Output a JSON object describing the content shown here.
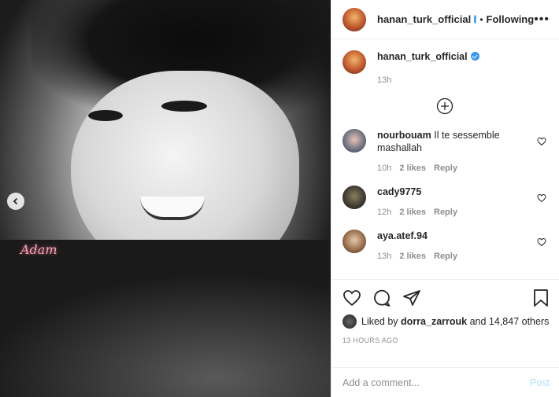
{
  "header": {
    "username": "hanan_turk_official",
    "separator": "•",
    "follow_label": "Following",
    "more_label": "•••"
  },
  "caption": {
    "username": "hanan_turk_official",
    "text": "",
    "time": "13h"
  },
  "image": {
    "overlay_text": "Adam"
  },
  "comments": [
    {
      "username": "nourbouam",
      "text": "Il te sessemble mashallah ",
      "time": "10h",
      "likes": "2 likes",
      "reply": "Reply"
    },
    {
      "username": "cady9775",
      "text": "",
      "time": "12h",
      "likes": "2 likes",
      "reply": "Reply"
    },
    {
      "username": "aya.atef.94",
      "text": "",
      "time": "13h",
      "likes": "2 likes",
      "reply": "Reply"
    }
  ],
  "likes": {
    "prefix": "Liked by",
    "user": "dorra_zarrouk",
    "suffix": "and 14,847 others"
  },
  "timestamp": "13 HOURS AGO",
  "add_comment": {
    "placeholder": "Add a comment...",
    "post_label": "Post"
  },
  "colors": {
    "verified": "#3897f0",
    "post_disabled": "#b2dffc",
    "meta": "#8e8e8e"
  }
}
